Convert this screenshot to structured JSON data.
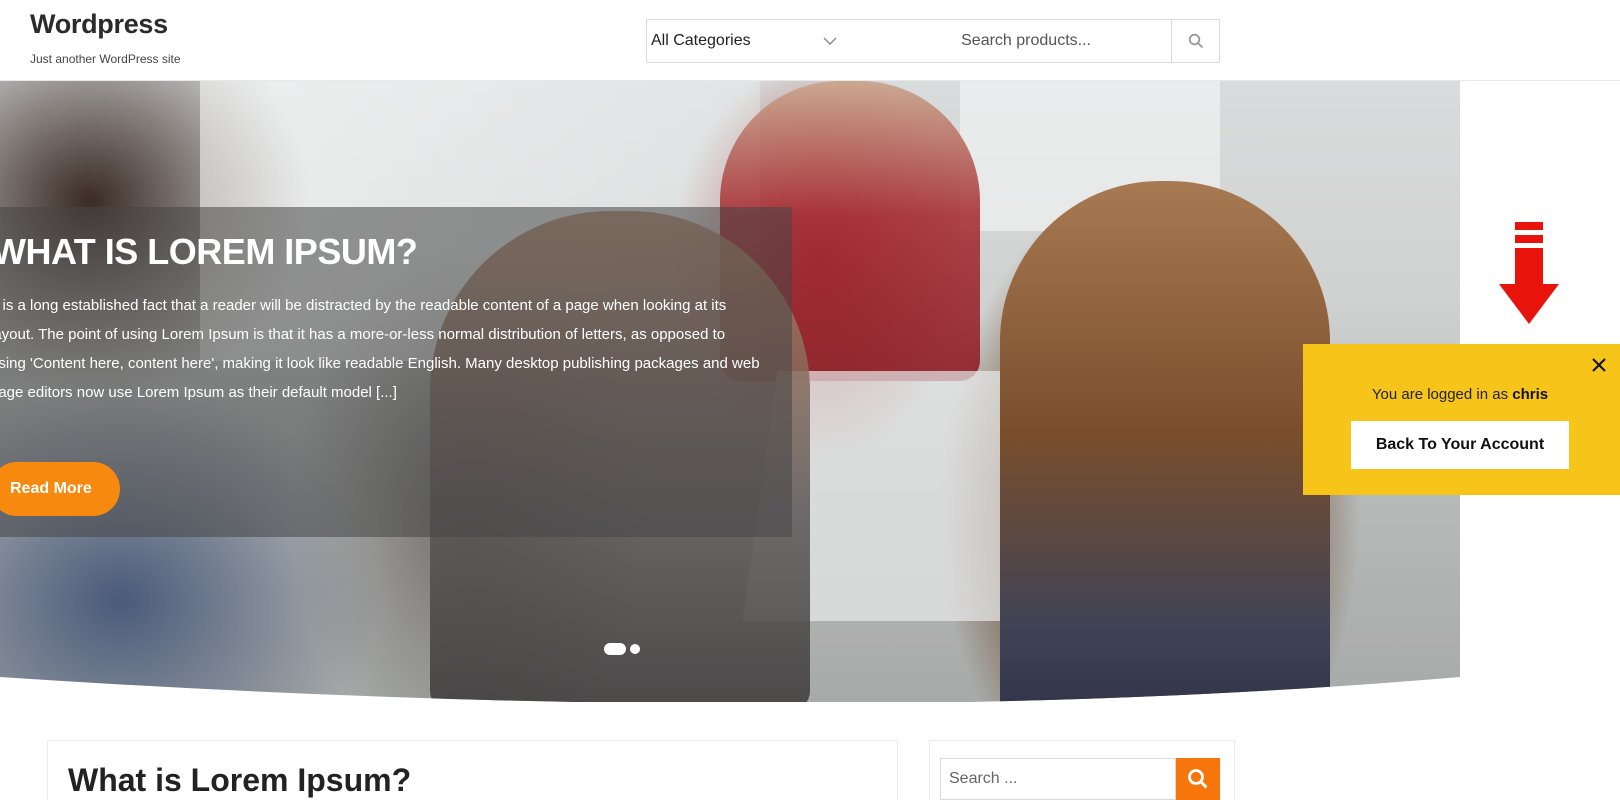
{
  "header": {
    "site_title": "Wordpress",
    "site_tagline": "Just another WordPress site",
    "category_select": "All Categories",
    "search_placeholder": "Search products..."
  },
  "hero": {
    "title": "WHAT IS LOREM IPSUM?",
    "text": "It is a long established fact that a reader will be distracted by the readable content of a page when looking at its layout. The point of using Lorem Ipsum is that it has a more-or-less normal distribution of letters, as opposed to using 'Content here, content here', making it look like readable English. Many desktop publishing packages and web page editors now use Lorem Ipsum as their default model [...]",
    "button_label": "Read More",
    "accent_color": "#f7890f"
  },
  "login_notice": {
    "text_prefix": "You are logged in as ",
    "username": "chris",
    "button_label": "Back To Your Account",
    "background_color": "#f7c419"
  },
  "main": {
    "post_title": "What is Lorem Ipsum?"
  },
  "sidebar": {
    "search_placeholder": "Search ..."
  },
  "icons": {
    "product_search": "search-icon",
    "category_dropdown": "chevron-down-icon",
    "login_close": "close-icon",
    "arrow": "down-arrow-icon",
    "widget_search": "search-icon"
  }
}
